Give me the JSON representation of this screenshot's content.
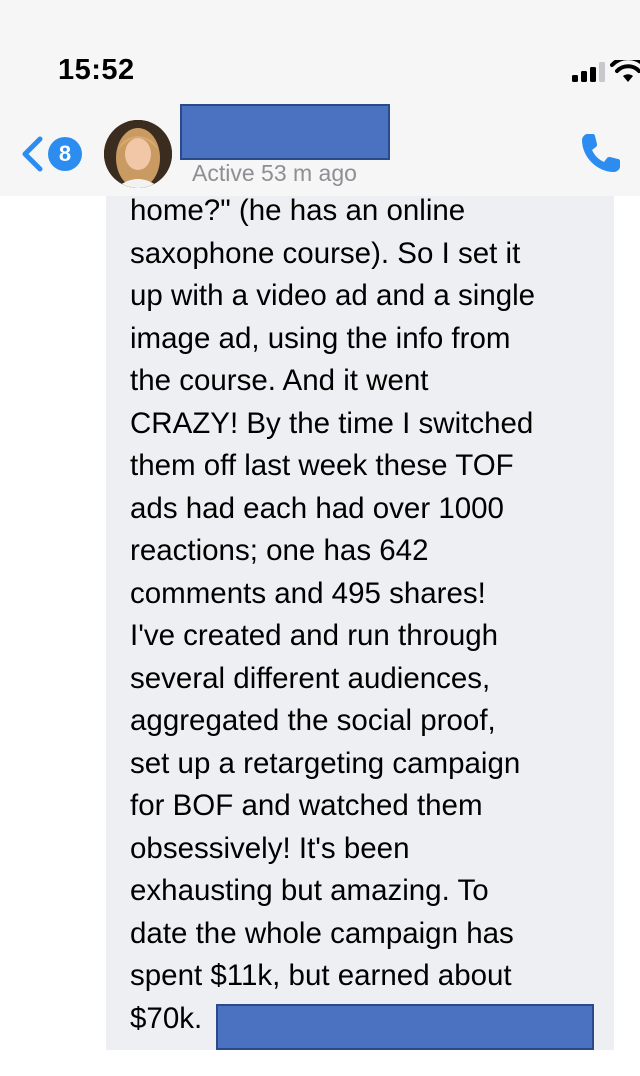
{
  "status_bar": {
    "time": "15:52",
    "signal_icon": "cellular-signal-icon",
    "wifi_icon": "wifi-icon"
  },
  "header": {
    "back_icon": "chevron-left-icon",
    "unread_count": "8",
    "contact_name_redacted": true,
    "active_status": "Active 53 m ago",
    "call_icon": "phone-icon"
  },
  "message": {
    "text": "home?\" (he has an online\nsaxophone course). So I set it\nup with a video ad and a single\nimage ad, using the info from\nthe course. And it went\nCRAZY!  By the time I switched\nthem off last week these TOF\nads had each had over 1000\nreactions; one has 642\ncomments and 495 shares!\nI've created and run through\nseveral different audiences,\naggregated the social proof,\nset up a retargeting campaign\nfor BOF and watched them\nobsessively! It's been\nexhausting but amazing. To\ndate the whole campaign has\nspent $11k, but earned about\n$70k.",
    "trailing_redacted": true
  },
  "colors": {
    "accent": "#2d8cf0",
    "bubble": "#eeeff2",
    "redaction": "#4a72c0",
    "secondary_text": "#8e8e93"
  }
}
